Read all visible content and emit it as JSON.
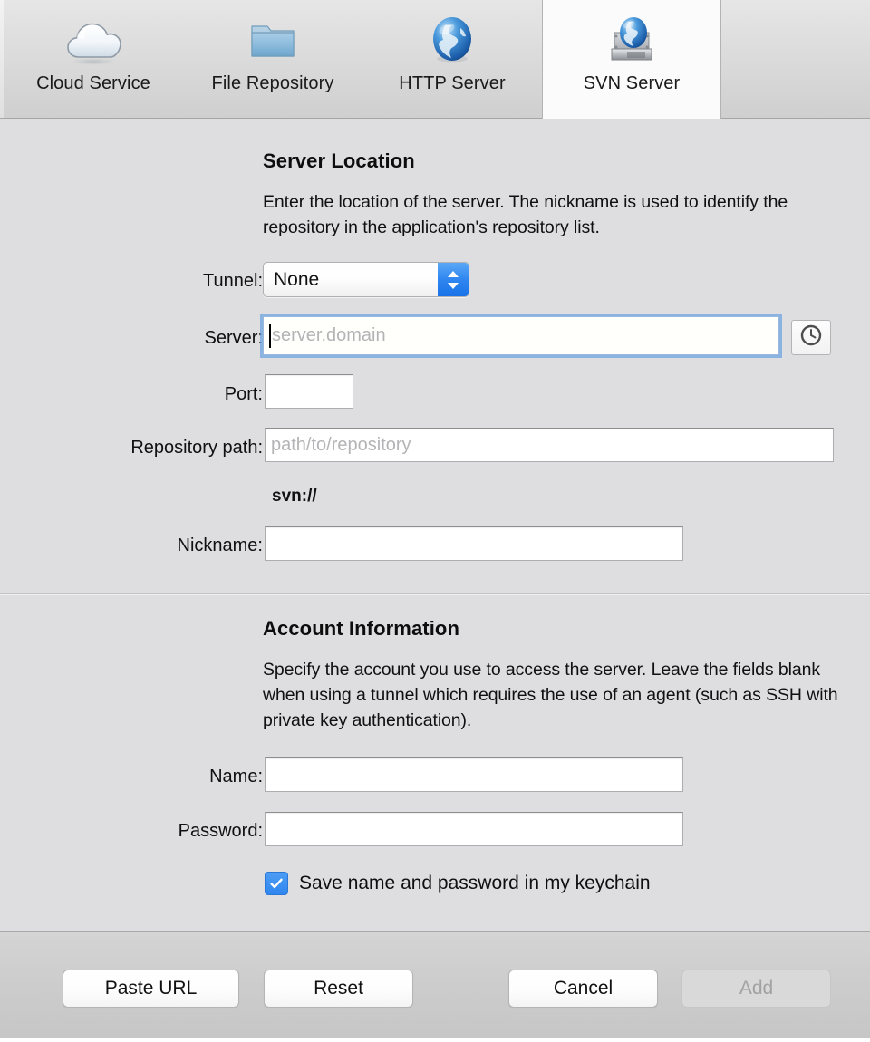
{
  "toolbar": {
    "tabs": [
      {
        "label": "Cloud Service",
        "icon": "cloud-icon",
        "selected": false
      },
      {
        "label": "File Repository",
        "icon": "folder-icon",
        "selected": false
      },
      {
        "label": "HTTP Server",
        "icon": "globe-icon",
        "selected": false
      },
      {
        "label": "SVN Server",
        "icon": "harddrive-globe-icon",
        "selected": true
      }
    ]
  },
  "server_location": {
    "title": "Server Location",
    "description": "Enter the location of the server. The nickname is used to identify the repository in the application's repository list.",
    "tunnel_label": "Tunnel:",
    "tunnel_value": "None",
    "server_label": "Server:",
    "server_value": "",
    "server_placeholder": "server.domain",
    "history_button_icon": "clock-icon",
    "port_label": "Port:",
    "port_value": "",
    "repository_path_label": "Repository path:",
    "repository_path_value": "",
    "repository_path_placeholder": "path/to/repository",
    "scheme_preview": "svn://",
    "nickname_label": "Nickname:",
    "nickname_value": ""
  },
  "account_information": {
    "title": "Account Information",
    "description": "Specify the account you use to access the server. Leave the fields blank when using a tunnel which requires the use of an agent (such as SSH with private key authentication).",
    "name_label": "Name:",
    "name_value": "",
    "password_label": "Password:",
    "password_value": "",
    "keychain_checkbox_label": "Save name and password in my keychain",
    "keychain_checked": true
  },
  "footer": {
    "paste_url_label": "Paste URL",
    "reset_label": "Reset",
    "cancel_label": "Cancel",
    "add_label": "Add",
    "add_disabled": true
  },
  "colors": {
    "accent_blue": "#2f86ef",
    "focus_ring": "#6ea4e2",
    "window_bg": "#dedee1",
    "toolbar_bg": "#dcdcdc",
    "selected_tab_bg": "#fbfbfb",
    "footer_bg": "#cccccc",
    "placeholder_text": "#b4b4b6"
  }
}
